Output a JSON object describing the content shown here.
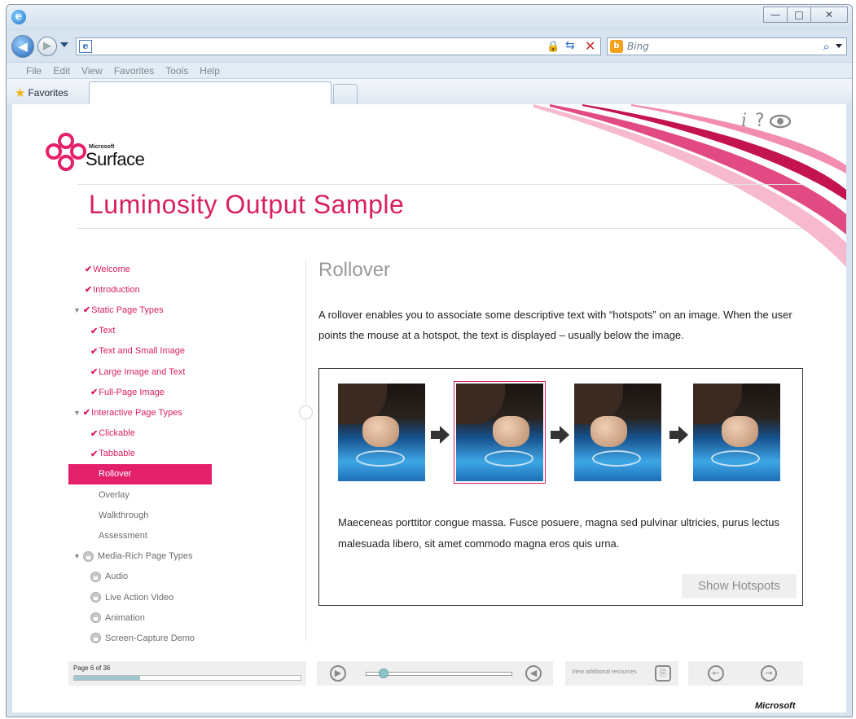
{
  "browser": {
    "logo_icon": "ie-logo-icon",
    "address_value": "",
    "search_placeholder": "Bing",
    "menu": [
      "File",
      "Edit",
      "View",
      "Favorites",
      "Tools",
      "Help"
    ],
    "favorites_label": "Favorites",
    "window_buttons": {
      "minimize": "—",
      "maximize": "□",
      "close": "✕"
    }
  },
  "page": {
    "brand_small": "Microsoft",
    "brand_name": "Surface",
    "title": "Luminosity Output Sample",
    "accent": "#d8205f"
  },
  "nav": {
    "items": [
      {
        "label": "Welcome",
        "state": "done"
      },
      {
        "label": "Introduction",
        "state": "done"
      },
      {
        "label": "Static Page Types",
        "state": "done-section"
      },
      {
        "label": "Text",
        "state": "done-child"
      },
      {
        "label": "Text and Small Image",
        "state": "done-child"
      },
      {
        "label": "Large Image and Text",
        "state": "done-child"
      },
      {
        "label": "Full-Page Image",
        "state": "done-child"
      },
      {
        "label": "Interactive Page Types",
        "state": "done-section"
      },
      {
        "label": "Clickable",
        "state": "done-child"
      },
      {
        "label": "Tabbable",
        "state": "done-child"
      },
      {
        "label": "Rollover",
        "state": "current"
      },
      {
        "label": "Overlay",
        "state": "todo"
      },
      {
        "label": "Walkthrough",
        "state": "todo"
      },
      {
        "label": "Assessment",
        "state": "todo"
      },
      {
        "label": "Media-Rich Page Types",
        "state": "locked-section"
      },
      {
        "label": "Audio",
        "state": "locked"
      },
      {
        "label": "Live Action Video",
        "state": "locked"
      },
      {
        "label": "Animation",
        "state": "locked"
      },
      {
        "label": "Screen-Capture Demo",
        "state": "locked"
      }
    ]
  },
  "main": {
    "section_title": "Rollover",
    "description": "A rollover enables you to associate some descriptive text with “hotspots” on an image. When the user points the mouse at a hotspot, the text is displayed – usually below the image.",
    "box_text": "Maeceneas porttitor congue massa. Fusce posuere, magna sed pulvinar ultricies, purus lectus malesuada libero, sit amet commodo magna eros quis urna.",
    "hotspots_button": "Show Hotspots",
    "selected_thumb": 2
  },
  "footer": {
    "page_label": "Page 6 of 36",
    "progress": 0.29,
    "resources_label": "View additional resources",
    "publisher": "Microsoft"
  }
}
